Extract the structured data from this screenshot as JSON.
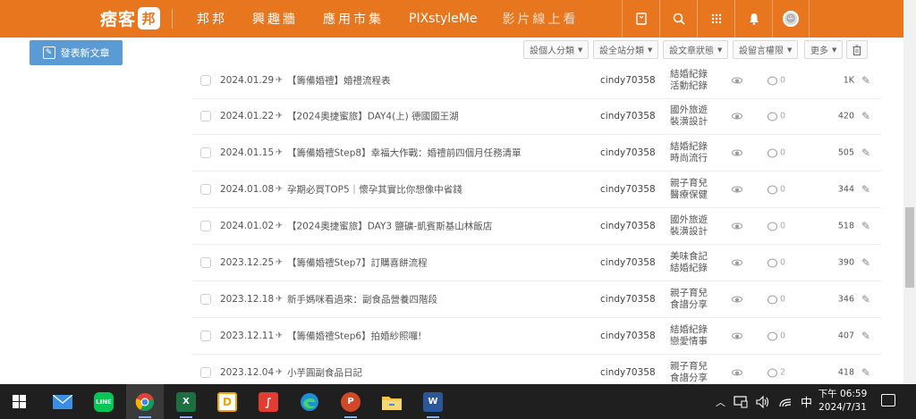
{
  "topbar": {
    "logo_text": "痞客",
    "logo_badge": "邦",
    "nav": [
      "邦邦",
      "興趣牆",
      "應用市集",
      "PIXstyleMe",
      "影片線上看"
    ],
    "icons": [
      "bookmark-icon",
      "search-icon",
      "apps-grid-icon",
      "bell-icon",
      "user-avatar"
    ]
  },
  "toolbar": {
    "compose_label": "發表新文章",
    "filters": [
      "設個人分類",
      "設全站分類",
      "設文章狀態",
      "設留言權限",
      "更多"
    ]
  },
  "posts": [
    {
      "date": "2024.01.29",
      "icon": "✈",
      "title": "【籌備婚禮】婚禮流程表",
      "author": "cindy70358",
      "cat1": "結婚紀錄",
      "cat2": "活動紀錄",
      "comments": "0",
      "views": "1K"
    },
    {
      "date": "2024.01.22",
      "icon": "✈",
      "title": "【2024奧捷蜜旅】DAY4(上) 德國國王湖",
      "author": "cindy70358",
      "cat1": "國外旅遊",
      "cat2": "裝潢設計",
      "comments": "0",
      "views": "420"
    },
    {
      "date": "2024.01.15",
      "icon": "✈",
      "title": "【籌備婚禮Step8】幸福大作戰：婚禮前四個月任務清單",
      "author": "cindy70358",
      "cat1": "結婚紀錄",
      "cat2": "時尚流行",
      "comments": "0",
      "views": "505"
    },
    {
      "date": "2024.01.08",
      "icon": "✈",
      "title": "孕期必買TOP5｜懷孕其實比你想像中省錢",
      "author": "cindy70358",
      "cat1": "親子育兒",
      "cat2": "醫療保健",
      "comments": "0",
      "views": "344"
    },
    {
      "date": "2024.01.02",
      "icon": "✈",
      "title": "【2024奧捷蜜旅】DAY3 鹽礦-凱賓斯基山林飯店",
      "author": "cindy70358",
      "cat1": "國外旅遊",
      "cat2": "裝潢設計",
      "comments": "0",
      "views": "518"
    },
    {
      "date": "2023.12.25",
      "icon": "✈",
      "title": "【籌備婚禮Step7】訂購喜餅流程",
      "author": "cindy70358",
      "cat1": "美味食記",
      "cat2": "結婚紀錄",
      "comments": "0",
      "views": "390"
    },
    {
      "date": "2023.12.18",
      "icon": "✈",
      "title": "新手媽咪看過來：副食品營養四階段",
      "author": "cindy70358",
      "cat1": "親子育兒",
      "cat2": "食譜分享",
      "comments": "0",
      "views": "346"
    },
    {
      "date": "2023.12.11",
      "icon": "✈",
      "title": "【籌備婚禮Step6】拍婚紗照囉!",
      "author": "cindy70358",
      "cat1": "結婚紀錄",
      "cat2": "戀愛情事",
      "comments": "0",
      "views": "407"
    },
    {
      "date": "2023.12.04",
      "icon": "✈",
      "title": "小芋圓副食品日記",
      "author": "cindy70358",
      "cat1": "親子育兒",
      "cat2": "食譜分享",
      "comments": "2",
      "views": "418"
    }
  ],
  "taskbar": {
    "apps": [
      "mail-app",
      "line-app",
      "chrome-app",
      "excel-app",
      "docs-app",
      "acrobat-app",
      "edge-app",
      "powerpoint-app",
      "file-explorer-app",
      "word-app"
    ],
    "ime": "中",
    "time": "下午 06:59",
    "date": "2024/7/31"
  },
  "colors": {
    "brand": "#e8761f",
    "compose": "#5b9bd5",
    "taskbar": "#1f1f1f"
  }
}
